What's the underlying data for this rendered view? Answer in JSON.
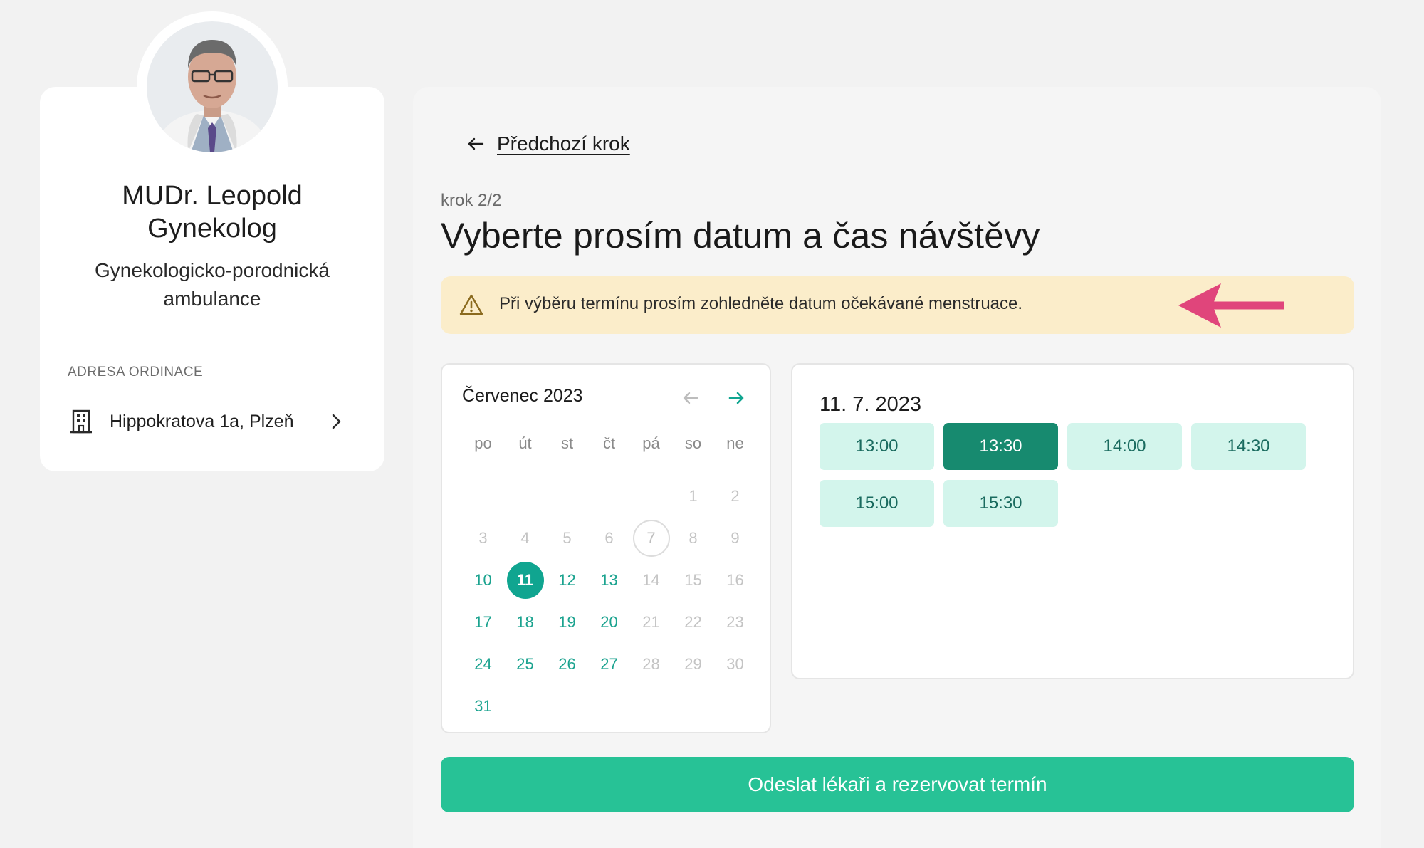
{
  "doctor": {
    "name_line1": "MUDr. Leopold",
    "name_line2": "Gynekolog",
    "spec_line1": "Gynekologicko-porodnická",
    "spec_line2": "ambulance",
    "address_label": "ADRESA ORDINACE",
    "address": "Hippokratova 1a, Plzeň"
  },
  "nav": {
    "back_label": "Předchozí krok"
  },
  "step": "krok 2/2",
  "title": "Vyberte prosím datum a čas návštěvy",
  "alert": {
    "text": "Při výběru termínu prosím zohledněte datum očekávané menstruace.",
    "accent_color": "#e0457b"
  },
  "calendar": {
    "month_label": "Červenec 2023",
    "weekdays": [
      "po",
      "út",
      "st",
      "čt",
      "pá",
      "so",
      "ne"
    ],
    "leading_blanks": 5,
    "days_in_month": 31,
    "available_days": [
      10,
      12,
      13,
      17,
      18,
      19,
      20,
      24,
      25,
      26,
      27,
      31
    ],
    "selected_day": 11,
    "today_day": 7
  },
  "slots": {
    "date_label": "11. 7. 2023",
    "times": [
      "13:00",
      "13:30",
      "14:00",
      "14:30",
      "15:00",
      "15:30"
    ],
    "selected": "13:30"
  },
  "submit_label": "Odeslat lékaři a rezervovat termín",
  "colors": {
    "primary": "#10a590",
    "submit": "#27c296",
    "slot_bg": "#d3f5ec",
    "slot_active": "#178a6f",
    "alert_bg": "#fbedca"
  }
}
